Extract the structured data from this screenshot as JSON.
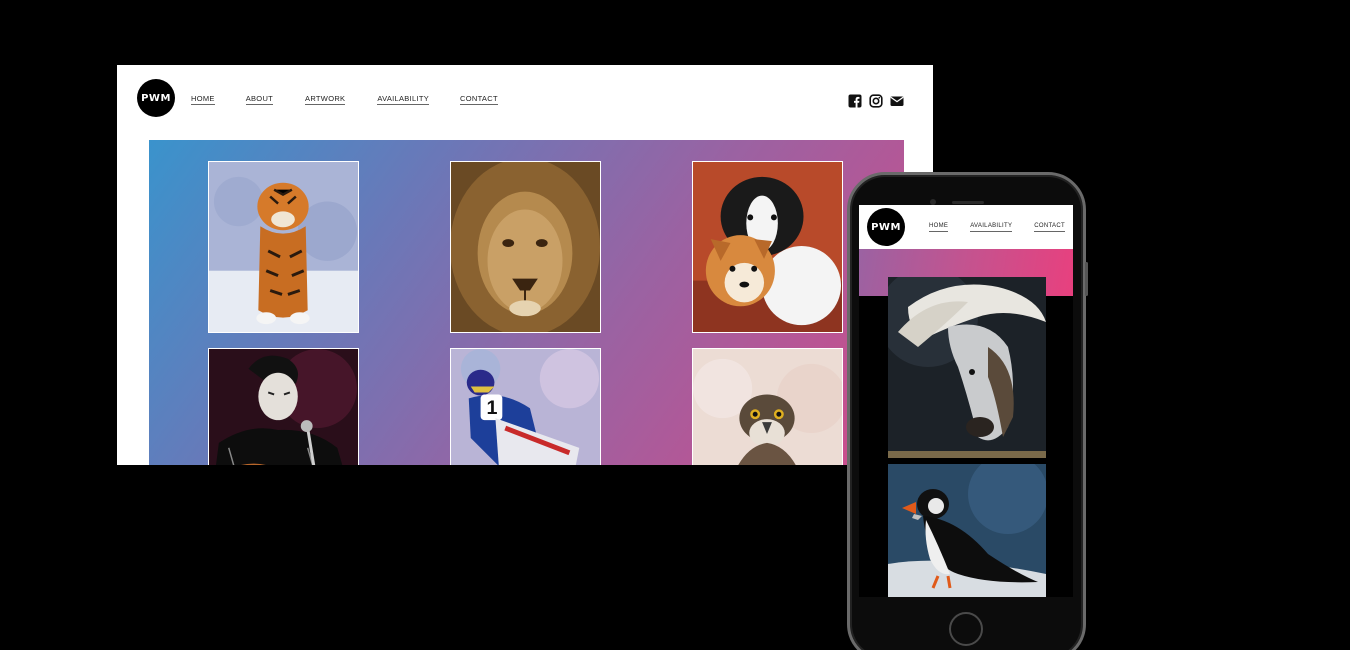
{
  "site": {
    "logo_text": "PWM",
    "nav": [
      "HOME",
      "ABOUT",
      "ARTWORK",
      "AVAILABILITY",
      "CONTACT"
    ],
    "social_icons": [
      "facebook-icon",
      "instagram-icon",
      "mail-icon"
    ]
  },
  "desktop": {
    "gallery_gradient": [
      "#3a93cc",
      "#d24a88"
    ],
    "artworks": [
      "tiger",
      "lion",
      "puppies",
      "elvis",
      "motorcycle-racer",
      "falcon"
    ]
  },
  "mobile": {
    "logo_text": "PWM",
    "nav": [
      "HOME",
      "AVAILABILITY",
      "CONTACT"
    ],
    "artworks": [
      "white-horse",
      "puffin"
    ]
  }
}
